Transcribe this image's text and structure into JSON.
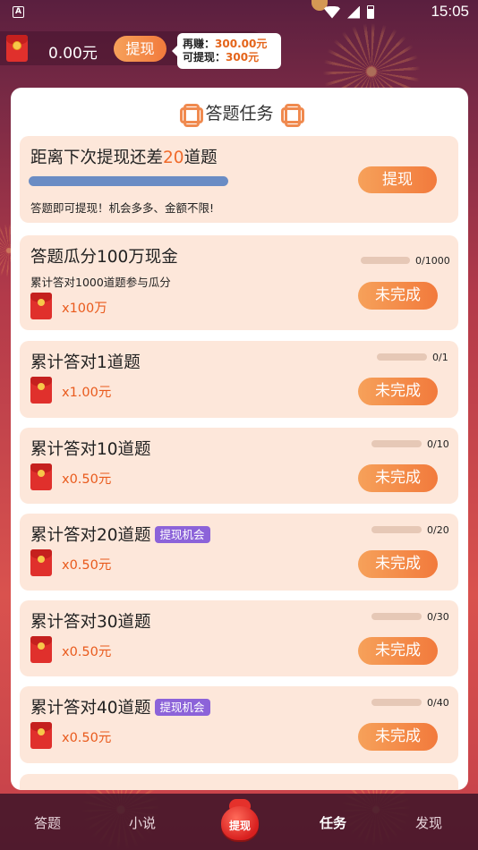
{
  "status_bar": {
    "time": "15:05",
    "a_label": "A"
  },
  "wallet": {
    "amount": "0.00元",
    "withdraw_label": "提现"
  },
  "tip": {
    "line1_label": "再赚：",
    "line1_value": "300.00元",
    "line2_label": "可提现：",
    "line2_value": "300元"
  },
  "panel": {
    "title": "答题任务"
  },
  "first_card": {
    "title_prefix": "距离下次提现还差",
    "title_number": "20",
    "title_suffix": "道题",
    "subtitle": "答题即可提现！机会多多、金额不限!",
    "button": "提现"
  },
  "tasks": [
    {
      "title": "答题瓜分100万现金",
      "subtitle": "累计答对1000道题参与瓜分",
      "reward": "x100万",
      "progress_text": "0/1000",
      "progress": 0,
      "button": "未完成",
      "badge": ""
    },
    {
      "title": "累计答对1道题",
      "subtitle": "",
      "reward": "x1.00元",
      "progress_text": "0/1",
      "progress": 0,
      "button": "未完成",
      "badge": ""
    },
    {
      "title": "累计答对10道题",
      "subtitle": "",
      "reward": "x0.50元",
      "progress_text": "0/10",
      "progress": 0,
      "button": "未完成",
      "badge": ""
    },
    {
      "title": "累计答对20道题",
      "subtitle": "",
      "reward": "x0.50元",
      "progress_text": "0/20",
      "progress": 0,
      "button": "未完成",
      "badge": "提现机会"
    },
    {
      "title": "累计答对30道题",
      "subtitle": "",
      "reward": "x0.50元",
      "progress_text": "0/30",
      "progress": 0,
      "button": "未完成",
      "badge": ""
    },
    {
      "title": "累计答对40道题",
      "subtitle": "",
      "reward": "x0.50元",
      "progress_text": "0/40",
      "progress": 0,
      "button": "未完成",
      "badge": "提现机会"
    }
  ],
  "bottom_nav": {
    "items": [
      "答题",
      "小说",
      "提现",
      "任务",
      "发现"
    ],
    "active": "任务"
  },
  "colors": {
    "accent": "#f27a3c",
    "badge": "#8c63d9",
    "card": "#fde7da",
    "highlight": "#f06a2a"
  }
}
